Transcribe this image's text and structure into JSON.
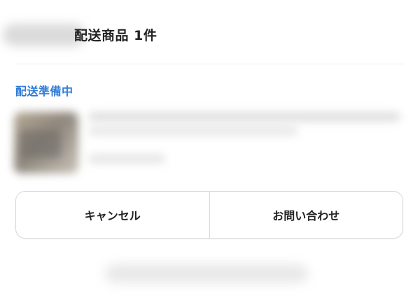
{
  "header": {
    "title": "配送商品 1件"
  },
  "status": {
    "label": "配送準備中",
    "color": "#2e7bd6"
  },
  "actions": {
    "cancel_label": "キャンセル",
    "contact_label": "お問い合わせ"
  }
}
